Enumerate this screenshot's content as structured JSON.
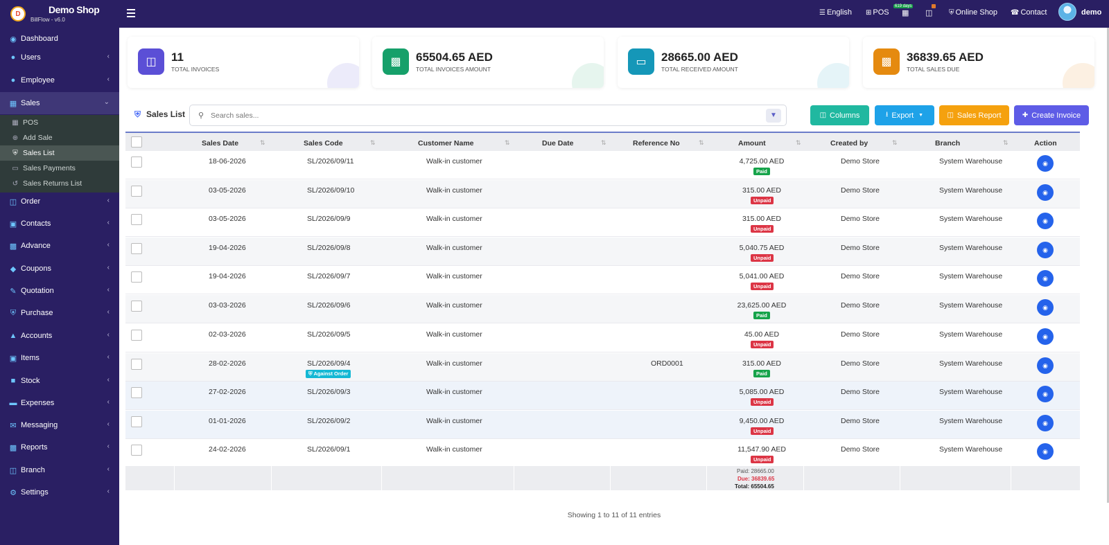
{
  "brand": {
    "name": "Demo Shop",
    "version": "BillFlow - v6.0",
    "logo_letter": "D"
  },
  "topnav": {
    "language": "English",
    "pos": "POS",
    "days_badge": "619 days",
    "online_shop": "Online Shop",
    "contact": "Contact",
    "user": "demo"
  },
  "sidebar": {
    "items": [
      {
        "label": "Dashboard"
      },
      {
        "label": "Users"
      },
      {
        "label": "Employee"
      },
      {
        "label": "Sales"
      },
      {
        "label": "Order"
      },
      {
        "label": "Contacts"
      },
      {
        "label": "Advance"
      },
      {
        "label": "Coupons"
      },
      {
        "label": "Quotation"
      },
      {
        "label": "Purchase"
      },
      {
        "label": "Accounts"
      },
      {
        "label": "Items"
      },
      {
        "label": "Stock"
      },
      {
        "label": "Expenses"
      },
      {
        "label": "Messaging"
      },
      {
        "label": "Reports"
      },
      {
        "label": "Branch"
      },
      {
        "label": "Settings"
      }
    ],
    "sales_sub": [
      {
        "label": "POS"
      },
      {
        "label": "Add Sale"
      },
      {
        "label": "Sales List"
      },
      {
        "label": "Sales Payments"
      },
      {
        "label": "Sales Returns List"
      }
    ]
  },
  "cards": [
    {
      "value": "11",
      "label": "TOTAL INVOICES",
      "color": "#5b4fd6"
    },
    {
      "value": "65504.65 AED",
      "label": "TOTAL INVOICES AMOUNT",
      "color": "#16a06a"
    },
    {
      "value": "28665.00 AED",
      "label": "TOTAL RECEIVED AMOUNT",
      "color": "#1597b8"
    },
    {
      "value": "36839.65 AED",
      "label": "TOTAL SALES DUE",
      "color": "#e58a0f"
    }
  ],
  "toolbar": {
    "title": "Sales List",
    "search_placeholder": "Search sales...",
    "columns": "Columns",
    "export": "Export",
    "sales_report": "Sales Report",
    "create_invoice": "Create Invoice"
  },
  "table": {
    "headers": [
      "Sales Date",
      "Sales Code",
      "Customer Name",
      "Due Date",
      "Reference No",
      "Amount",
      "Created by",
      "Branch",
      "Action"
    ],
    "rows": [
      {
        "date": "18-06-2026",
        "code": "SL/2026/09/11",
        "customer": "Walk-in customer",
        "due": "",
        "ref": "",
        "amount": "4,725.00 AED",
        "status": "Paid",
        "created": "Demo Store",
        "branch": "System Warehouse",
        "tag": ""
      },
      {
        "date": "03-05-2026",
        "code": "SL/2026/09/10",
        "customer": "Walk-in customer",
        "due": "",
        "ref": "",
        "amount": "315.00 AED",
        "status": "Unpaid",
        "created": "Demo Store",
        "branch": "System Warehouse",
        "tag": ""
      },
      {
        "date": "03-05-2026",
        "code": "SL/2026/09/9",
        "customer": "Walk-in customer",
        "due": "",
        "ref": "",
        "amount": "315.00 AED",
        "status": "Unpaid",
        "created": "Demo Store",
        "branch": "System Warehouse",
        "tag": ""
      },
      {
        "date": "19-04-2026",
        "code": "SL/2026/09/8",
        "customer": "Walk-in customer",
        "due": "",
        "ref": "",
        "amount": "5,040.75 AED",
        "status": "Unpaid",
        "created": "Demo Store",
        "branch": "System Warehouse",
        "tag": ""
      },
      {
        "date": "19-04-2026",
        "code": "SL/2026/09/7",
        "customer": "Walk-in customer",
        "due": "",
        "ref": "",
        "amount": "5,041.00 AED",
        "status": "Unpaid",
        "created": "Demo Store",
        "branch": "System Warehouse",
        "tag": ""
      },
      {
        "date": "03-03-2026",
        "code": "SL/2026/09/6",
        "customer": "Walk-in customer",
        "due": "",
        "ref": "",
        "amount": "23,625.00 AED",
        "status": "Paid",
        "created": "Demo Store",
        "branch": "System Warehouse",
        "tag": ""
      },
      {
        "date": "02-03-2026",
        "code": "SL/2026/09/5",
        "customer": "Walk-in customer",
        "due": "",
        "ref": "",
        "amount": "45.00 AED",
        "status": "Unpaid",
        "created": "Demo Store",
        "branch": "System Warehouse",
        "tag": ""
      },
      {
        "date": "28-02-2026",
        "code": "SL/2026/09/4",
        "customer": "Walk-in customer",
        "due": "",
        "ref": "ORD0001",
        "amount": "315.00 AED",
        "status": "Paid",
        "created": "Demo Store",
        "branch": "System Warehouse",
        "tag": "Against Order"
      },
      {
        "date": "27-02-2026",
        "code": "SL/2026/09/3",
        "customer": "Walk-in customer",
        "due": "",
        "ref": "",
        "amount": "5,085.00 AED",
        "status": "Unpaid",
        "created": "Demo Store",
        "branch": "System Warehouse",
        "tag": ""
      },
      {
        "date": "01-01-2026",
        "code": "SL/2026/09/2",
        "customer": "Walk-in customer",
        "due": "",
        "ref": "",
        "amount": "9,450.00 AED",
        "status": "Unpaid",
        "created": "Demo Store",
        "branch": "System Warehouse",
        "tag": ""
      },
      {
        "date": "24-02-2026",
        "code": "SL/2026/09/1",
        "customer": "Walk-in customer",
        "due": "",
        "ref": "",
        "amount": "11,547.90 AED",
        "status": "Unpaid",
        "created": "Demo Store",
        "branch": "System Warehouse",
        "tag": ""
      }
    ],
    "footer": {
      "paid": "Paid: 28665.00",
      "due": "Due: 36839.65",
      "total": "Total: 65504.65"
    }
  },
  "showing": "Showing 1 to 11 of 11 entries"
}
